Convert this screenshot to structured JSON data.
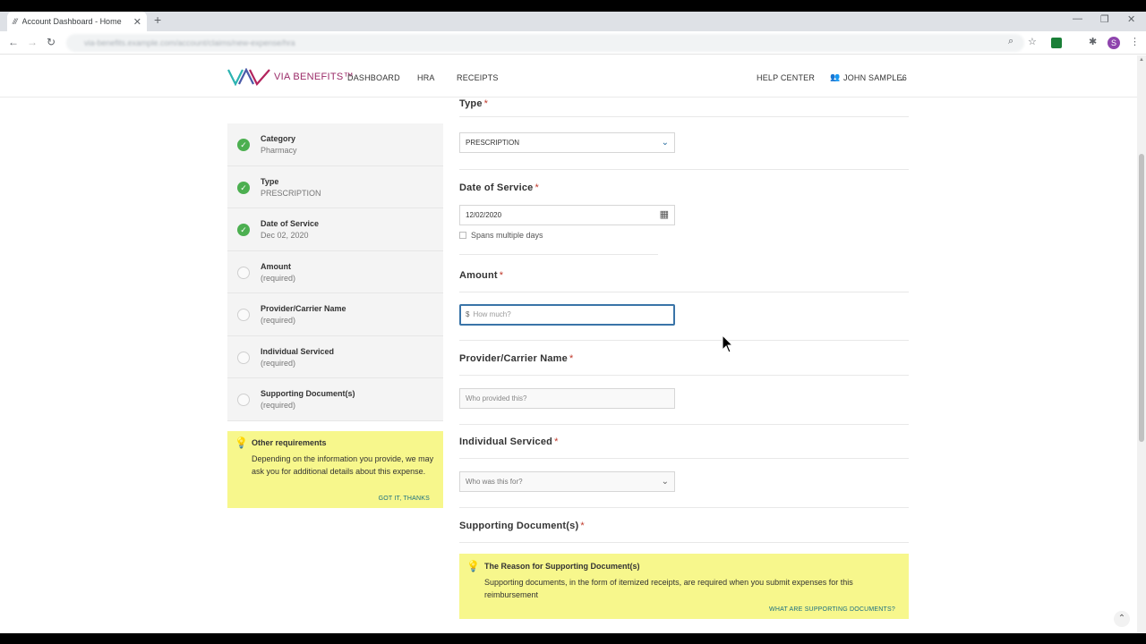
{
  "browser": {
    "tab_title": "Account Dashboard - Home",
    "tab_favicon": "///",
    "close_glyph": "✕",
    "new_tab_glyph": "+",
    "url": "via-benefits.example.com/account/claims/new-expense/hra",
    "profile_initial": "S",
    "window": {
      "minimize": "—",
      "restore": "❐",
      "close": "✕"
    }
  },
  "header": {
    "logo_text": "VIA BENEFITS™",
    "nav": [
      "DASHBOARD",
      "HRA",
      "RECEIPTS"
    ],
    "help": "HELP CENTER",
    "user": "JOHN SAMPLE6"
  },
  "steps": [
    {
      "label": "Category",
      "value": "Pharmacy",
      "done": true
    },
    {
      "label": "Type",
      "value": "PRESCRIPTION",
      "done": true
    },
    {
      "label": "Date of Service",
      "value": "Dec 02, 2020",
      "done": true
    },
    {
      "label": "Amount",
      "value": "(required)",
      "done": false
    },
    {
      "label": "Provider/Carrier Name",
      "value": "(required)",
      "done": false
    },
    {
      "label": "Individual Serviced",
      "value": "(required)",
      "done": false
    },
    {
      "label": "Supporting Document(s)",
      "value": "(required)",
      "done": false
    }
  ],
  "other_requirements": {
    "title": "Other requirements",
    "body": "Depending on the information you provide, we may ask you for additional details about this expense.",
    "link": "GOT IT, THANKS"
  },
  "form": {
    "type": {
      "label": "Type",
      "required_mark": "*",
      "value": "PRESCRIPTION"
    },
    "date_of_service": {
      "label": "Date of Service",
      "required_mark": "*",
      "value": "12/02/2020",
      "spans_label": "Spans multiple days"
    },
    "amount": {
      "label": "Amount",
      "required_mark": "*",
      "currency": "$",
      "placeholder": "How much?"
    },
    "provider": {
      "label": "Provider/Carrier Name",
      "required_mark": "*",
      "placeholder": "Who provided this?"
    },
    "individual": {
      "label": "Individual Serviced",
      "required_mark": "*",
      "placeholder": "Who was this for?"
    },
    "documents": {
      "label": "Supporting Document(s)",
      "required_mark": "*"
    }
  },
  "doc_note": {
    "title": "The Reason for Supporting Document(s)",
    "body": "Supporting documents, in the form of itemized receipts, are required when you submit expenses for this reimbursement",
    "link": "WHAT ARE SUPPORTING DOCUMENTS?"
  },
  "colors": {
    "accent": "#3a74a8",
    "success": "#4caf50",
    "note_bg": "#f7f78c",
    "brand": "#9b2b68"
  }
}
